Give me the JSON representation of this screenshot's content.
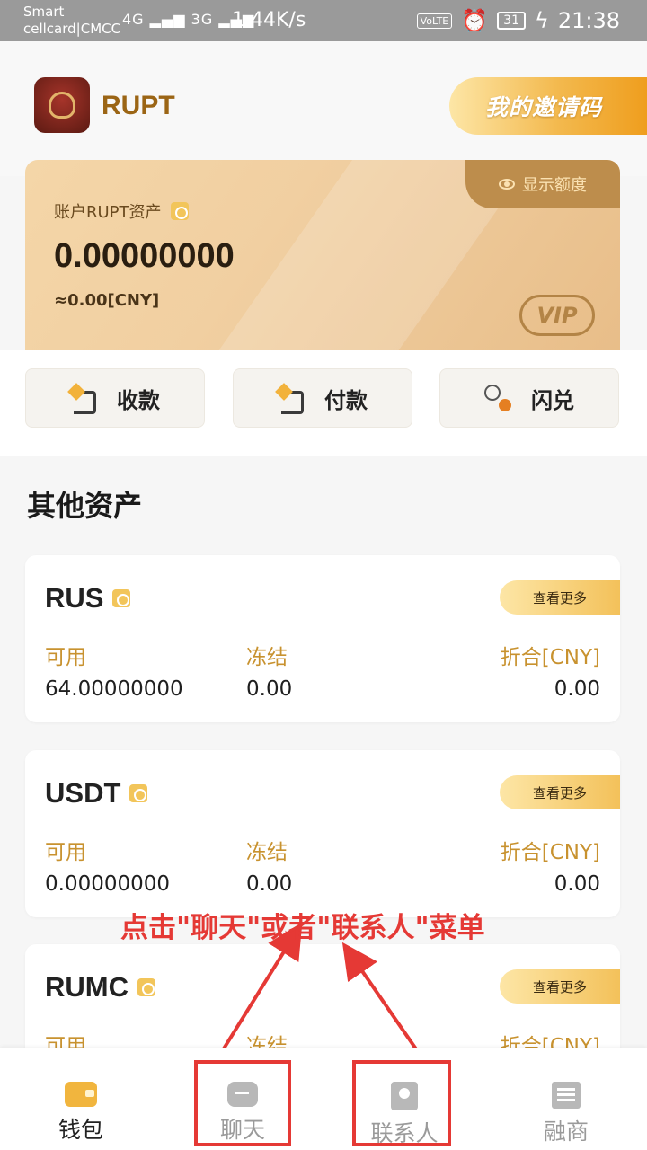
{
  "status_bar": {
    "carrier_line1": "Smart",
    "carrier_line2": "cellcard|CMCC",
    "signal": "4G ▂▄▆ 3G ▂▄▆",
    "net_speed": "1.44K/s",
    "volte": "VoLTE",
    "alarm_icon": "⏰",
    "battery": "31",
    "charging": "ϟ",
    "time": "21:38"
  },
  "header": {
    "app_name": "RUPT",
    "invite_label": "我的邀请码"
  },
  "asset_card": {
    "show_amount_label": "显示额度",
    "label": "账户RUPT资产",
    "amount": "0.00000000",
    "cny": "≈0.00[CNY]",
    "vip": "VIP"
  },
  "actions": [
    {
      "label": "收款"
    },
    {
      "label": "付款"
    },
    {
      "label": "闪兑"
    }
  ],
  "other_assets": {
    "title": "其他资产",
    "more_label": "查看更多",
    "col_available": "可用",
    "col_frozen": "冻结",
    "col_cny": "折合[CNY]",
    "tokens": [
      {
        "name": "RUS",
        "available": "64.00000000",
        "frozen": "0.00",
        "cny": "0.00"
      },
      {
        "name": "USDT",
        "available": "0.00000000",
        "frozen": "0.00",
        "cny": "0.00"
      },
      {
        "name": "RUMC",
        "available": "",
        "frozen": "",
        "cny": ""
      }
    ]
  },
  "annotation": {
    "text": "点击\"聊天\"或者\"联系人\"菜单",
    "color": "#e53935"
  },
  "bottom_nav": [
    {
      "label": "钱包",
      "icon": "wallet-icon",
      "active": true
    },
    {
      "label": "聊天",
      "icon": "chat-icon",
      "active": false
    },
    {
      "label": "联系人",
      "icon": "contact-icon",
      "active": false
    },
    {
      "label": "融商",
      "icon": "merchant-icon",
      "active": false
    }
  ]
}
